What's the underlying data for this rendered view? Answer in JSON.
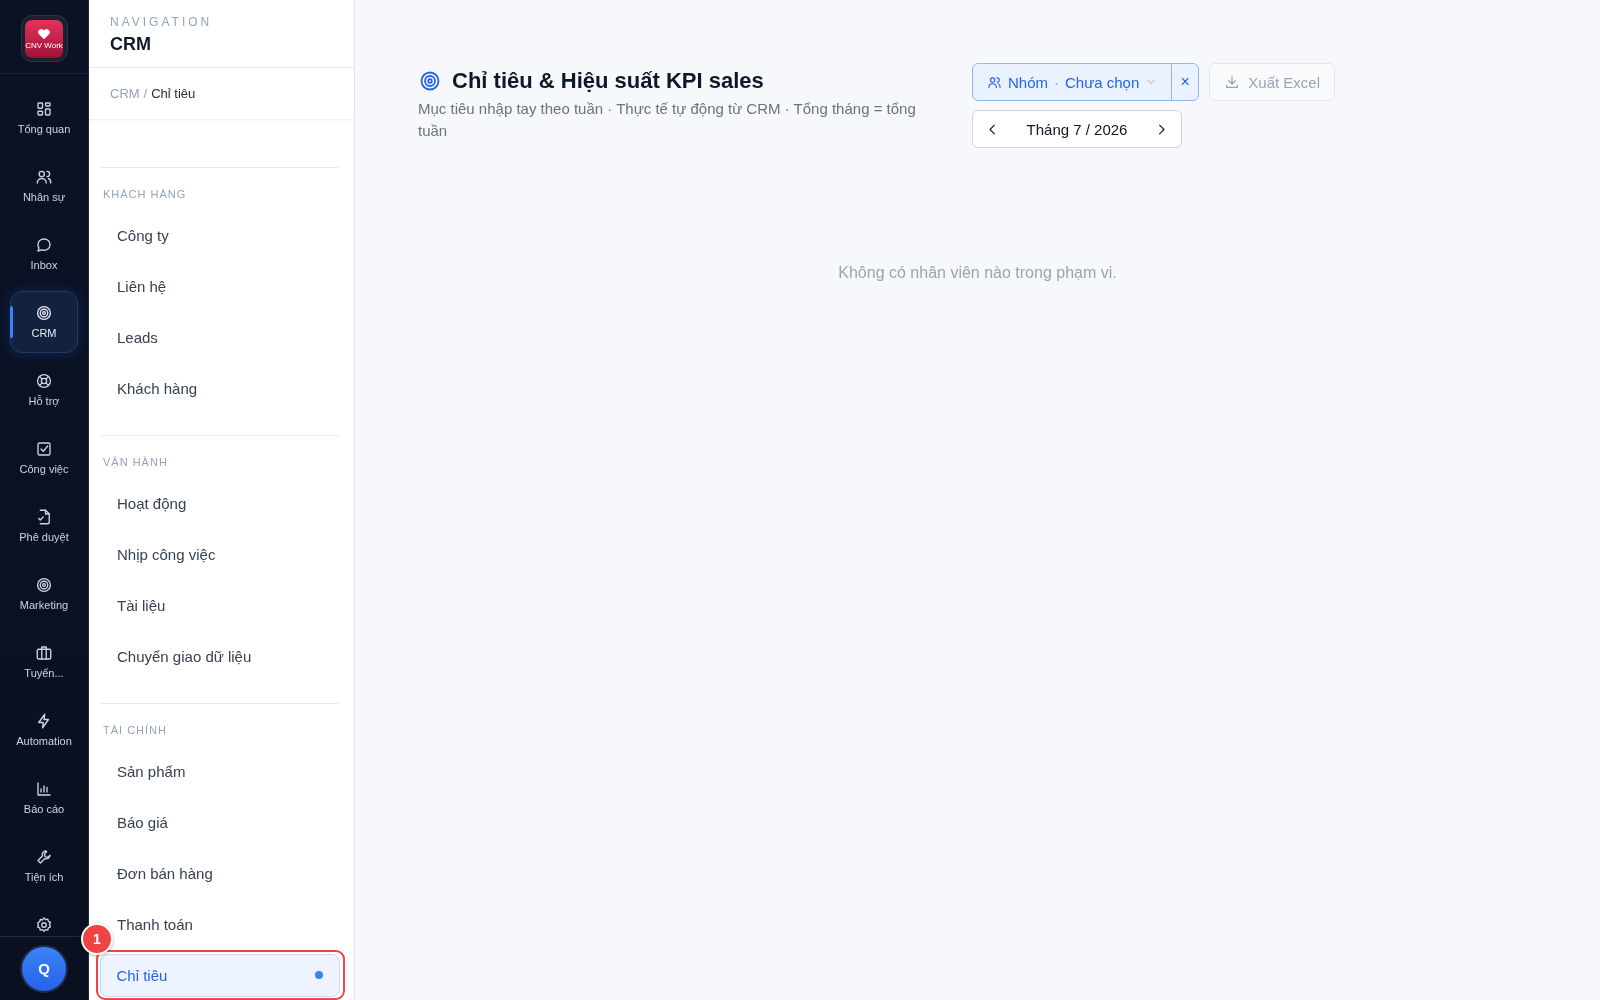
{
  "rail": {
    "logo_text": "CNV Work",
    "items": [
      {
        "label": "Tổng quan",
        "selected": false
      },
      {
        "label": "Nhân sự",
        "selected": false
      },
      {
        "label": "Inbox",
        "selected": false
      },
      {
        "label": "CRM",
        "selected": true
      },
      {
        "label": "Hỗ trợ",
        "selected": false
      },
      {
        "label": "Công việc",
        "selected": false
      },
      {
        "label": "Phê duyệt",
        "selected": false
      },
      {
        "label": "Marketing",
        "selected": false
      },
      {
        "label": "Tuyển...",
        "selected": false
      },
      {
        "label": "Automation",
        "selected": false
      },
      {
        "label": "Báo cáo",
        "selected": false
      },
      {
        "label": "Tiện ích",
        "selected": false
      },
      {
        "selected": false
      }
    ],
    "user_initial": "Q"
  },
  "sidebar": {
    "heading": "NAVIGATION",
    "title": "CRM",
    "breadcrumb": {
      "parent": "CRM",
      "separator": "/",
      "current": "Chỉ tiêu"
    },
    "sections": [
      {
        "title": "KHÁCH HÀNG",
        "items": [
          {
            "label": "Công ty",
            "selected": false
          },
          {
            "label": "Liên hệ",
            "selected": false
          },
          {
            "label": "Leads",
            "selected": false
          },
          {
            "label": "Khách hàng",
            "selected": false
          }
        ]
      },
      {
        "title": "VẬN HÀNH",
        "items": [
          {
            "label": "Hoạt động",
            "selected": false
          },
          {
            "label": "Nhịp công việc",
            "selected": false
          },
          {
            "label": "Tài liệu",
            "selected": false
          },
          {
            "label": "Chuyển giao dữ liệu",
            "selected": false
          }
        ]
      },
      {
        "title": "TÀI CHÍNH",
        "items": [
          {
            "label": "Sản phẩm",
            "selected": false
          },
          {
            "label": "Báo giá",
            "selected": false
          },
          {
            "label": "Đơn bán hàng",
            "selected": false
          },
          {
            "label": "Thanh toán",
            "selected": false
          },
          {
            "label": "Chỉ tiêu",
            "selected": true
          }
        ]
      }
    ]
  },
  "annotation": {
    "label": "1"
  },
  "page": {
    "title": "Chỉ tiêu & Hiệu suất KPI sales",
    "subtitle": "Mục tiêu nhập tay theo tuần · Thực tế tự động từ CRM · Tổng tháng = tổng tuần",
    "group_filter": {
      "label": "Nhóm",
      "separator": "·",
      "value": "Chưa chọn",
      "clear": "×"
    },
    "export_button": "Xuất Excel",
    "month": "Tháng 7 / 2026",
    "empty_message": "Không có nhân viên nào trong phạm vi."
  }
}
